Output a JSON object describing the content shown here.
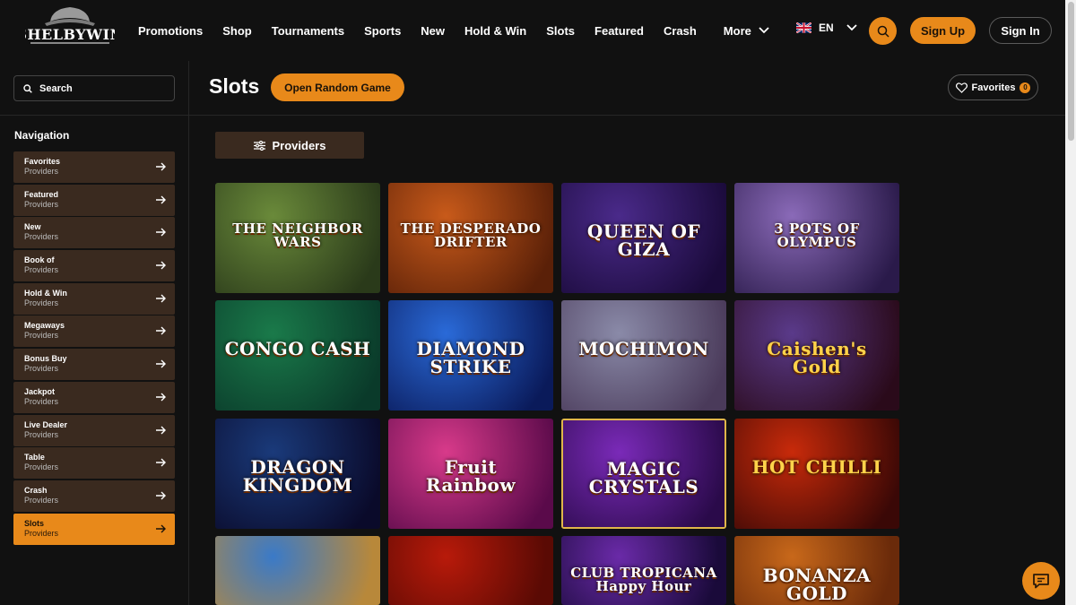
{
  "brand": {
    "name": "SHELBYWIN"
  },
  "header": {
    "nav": [
      "Promotions",
      "Shop",
      "Tournaments",
      "Sports",
      "New",
      "Hold & Win",
      "Slots",
      "Featured",
      "Crash"
    ],
    "more_label": "More",
    "language": "EN",
    "signup_label": "Sign Up",
    "signin_label": "Sign In",
    "accent": "#e8891a"
  },
  "sidebar": {
    "search_placeholder": "Search",
    "nav_title": "Navigation",
    "items": [
      {
        "label": "Favorites",
        "sub": "Providers",
        "active": false
      },
      {
        "label": "Featured",
        "sub": "Providers",
        "active": false
      },
      {
        "label": "New",
        "sub": "Providers",
        "active": false
      },
      {
        "label": "Book of",
        "sub": "Providers",
        "active": false
      },
      {
        "label": "Hold & Win",
        "sub": "Providers",
        "active": false
      },
      {
        "label": "Megaways",
        "sub": "Providers",
        "active": false
      },
      {
        "label": "Bonus Buy",
        "sub": "Providers",
        "active": false
      },
      {
        "label": "Jackpot",
        "sub": "Providers",
        "active": false
      },
      {
        "label": "Live Dealer",
        "sub": "Providers",
        "active": false
      },
      {
        "label": "Table",
        "sub": "Providers",
        "active": false
      },
      {
        "label": "Crash",
        "sub": "Providers",
        "active": false
      },
      {
        "label": "Slots",
        "sub": "Providers",
        "active": true
      }
    ]
  },
  "main": {
    "title": "Slots",
    "random_label": "Open Random Game",
    "favorites_label": "Favorites",
    "favorites_count": "0",
    "providers_label": "Providers",
    "games": [
      {
        "title": "THE NEIGHBOR WARS",
        "bg": [
          "#6a8a3a",
          "#2a3a1a"
        ]
      },
      {
        "title": "THE DESPERADO DRIFTER",
        "bg": [
          "#c85a1a",
          "#5a2008"
        ]
      },
      {
        "title": "QUEEN OF GIZA",
        "bg": [
          "#4a2a8a",
          "#1a0a3a"
        ]
      },
      {
        "title": "3 POTS OF OLYMPUS",
        "bg": [
          "#8a6ab8",
          "#2a1a4a"
        ]
      },
      {
        "title": "CONGO CASH",
        "bg": [
          "#1a7a4a",
          "#0a3a2a"
        ]
      },
      {
        "title": "DIAMOND STRIKE",
        "bg": [
          "#2a6ad8",
          "#0a1a5a"
        ]
      },
      {
        "title": "MOCHIMON",
        "bg": [
          "#8a8aa8",
          "#4a3a5a"
        ]
      },
      {
        "title": "Caishen's Gold",
        "bg": [
          "#5a3a8a",
          "#2a0a1a"
        ]
      },
      {
        "title": "DRAGON KINGDOM",
        "bg": [
          "#1a3a7a",
          "#0a0a2a"
        ]
      },
      {
        "title": "Fruit Rainbow",
        "bg": [
          "#d83a8a",
          "#5a0a4a"
        ]
      },
      {
        "title": "MAGIC CRYSTALS",
        "bg": [
          "#7a2ab8",
          "#2a0a4a"
        ]
      },
      {
        "title": "HOT CHILLI",
        "bg": [
          "#c82a0a",
          "#3a0806"
        ]
      },
      {
        "title": "",
        "bg": [
          "#3a7ac8",
          "#b8883a"
        ]
      },
      {
        "title": "",
        "bg": [
          "#b81a0a",
          "#5a0a04"
        ]
      },
      {
        "title": "CLUB TROPICANA Happy Hour",
        "bg": [
          "#6a2aa8",
          "#1a0a3a"
        ]
      },
      {
        "title": "BONANZA GOLD",
        "bg": [
          "#c8681a",
          "#6a2a0a"
        ]
      }
    ]
  }
}
